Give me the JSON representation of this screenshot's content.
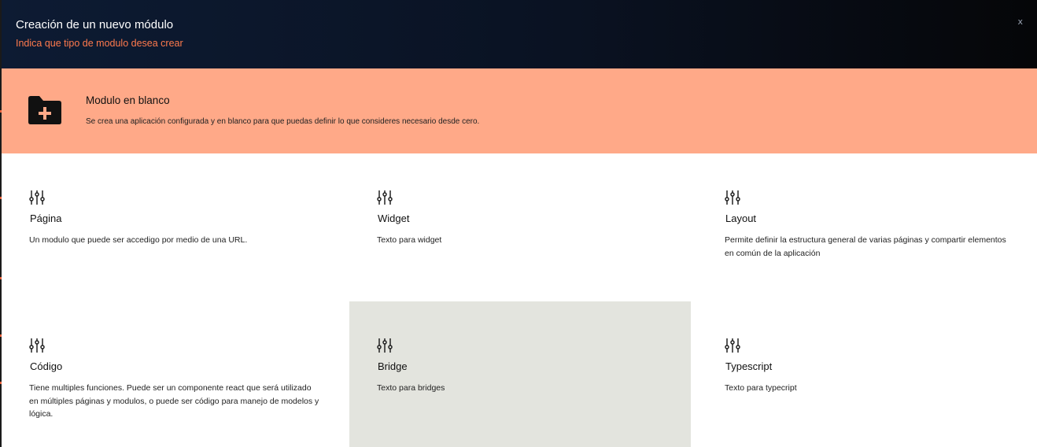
{
  "header": {
    "title": "Creación de un nuevo módulo",
    "subtitle": "Indica que tipo de modulo desea crear",
    "close_label": "x"
  },
  "blank_module": {
    "icon": "folder-plus-icon",
    "title": "Modulo en blanco",
    "description": "Se crea una aplicación configurada y en blanco para que puedas definir lo que consideres necesario desde cero."
  },
  "module_types": [
    {
      "icon": "sliders-icon",
      "title": "Página",
      "description": "Un modulo que puede ser accedigo por medio de una URL."
    },
    {
      "icon": "sliders-icon",
      "title": "Widget",
      "description": "Texto para widget"
    },
    {
      "icon": "sliders-icon",
      "title": "Layout",
      "description": "Permite definir la estructura general de varias páginas y compartir elementos en común de la aplicación"
    },
    {
      "icon": "sliders-icon",
      "title": "Código",
      "description": "Tiene multiples funciones. Puede ser un componente react que será utilizado en múltiples páginas y modulos, o puede ser código para manejo de modelos y lógica."
    },
    {
      "icon": "sliders-icon",
      "title": "Bridge",
      "description": "Texto para bridges"
    },
    {
      "icon": "sliders-icon",
      "title": "Typescript",
      "description": "Texto para typecript"
    }
  ],
  "colors": {
    "header_bg": "#0d1b33",
    "accent": "#ff7a4d",
    "blank_module_bg": "#ffa988",
    "hover_card_bg": "#e3e4de"
  }
}
